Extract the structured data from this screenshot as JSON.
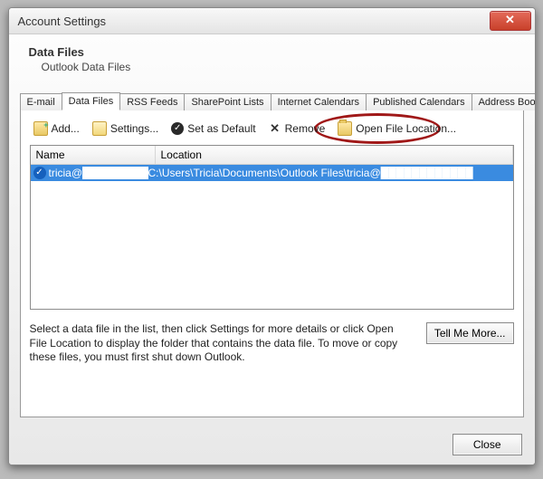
{
  "window": {
    "title": "Account Settings"
  },
  "header": {
    "title": "Data Files",
    "subtitle": "Outlook Data Files"
  },
  "tabs": [
    {
      "label": "E-mail"
    },
    {
      "label": "Data Files"
    },
    {
      "label": "RSS Feeds"
    },
    {
      "label": "SharePoint Lists"
    },
    {
      "label": "Internet Calendars"
    },
    {
      "label": "Published Calendars"
    },
    {
      "label": "Address Books"
    }
  ],
  "toolbar": {
    "add": "Add...",
    "settings": "Settings...",
    "set_default": "Set as Default",
    "remove": "Remove",
    "open_location": "Open File Location..."
  },
  "columns": {
    "name": "Name",
    "location": "Location"
  },
  "rows": [
    {
      "name": "tricia@████████████",
      "location": "C:\\Users\\Tricia\\Documents\\Outlook Files\\tricia@████████████"
    }
  ],
  "hint": "Select a data file in the list, then click Settings for more details or click Open File Location to display the folder that contains the data file. To move or copy these files, you must first shut down Outlook.",
  "tell_more": "Tell Me More...",
  "close": "Close"
}
